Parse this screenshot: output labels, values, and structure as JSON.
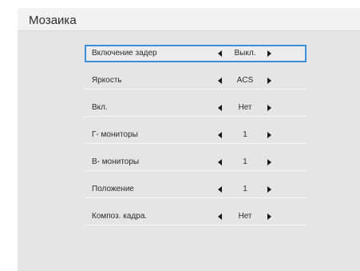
{
  "window": {
    "title": "Мозаика"
  },
  "menu": {
    "items": [
      {
        "label": "Включение задер",
        "value": "Выкл."
      },
      {
        "label": "Яркость",
        "value": "ACS"
      },
      {
        "label": "Вкл.",
        "value": "Нет"
      },
      {
        "label": "Г- мониторы",
        "value": "1"
      },
      {
        "label": "В- мониторы",
        "value": "1"
      },
      {
        "label": "Положение",
        "value": "1"
      },
      {
        "label": "Композ. кадра.",
        "value": "Нет"
      }
    ],
    "selected_label": "Включение задер"
  },
  "icons": {
    "left": "triangle-left-icon",
    "right": "triangle-right-icon"
  },
  "colors": {
    "panel_bg": "#e5e5e5",
    "title_bg": "#f2f2f2",
    "selection_border": "#3b8fd8",
    "text": "#2b2b2b"
  }
}
